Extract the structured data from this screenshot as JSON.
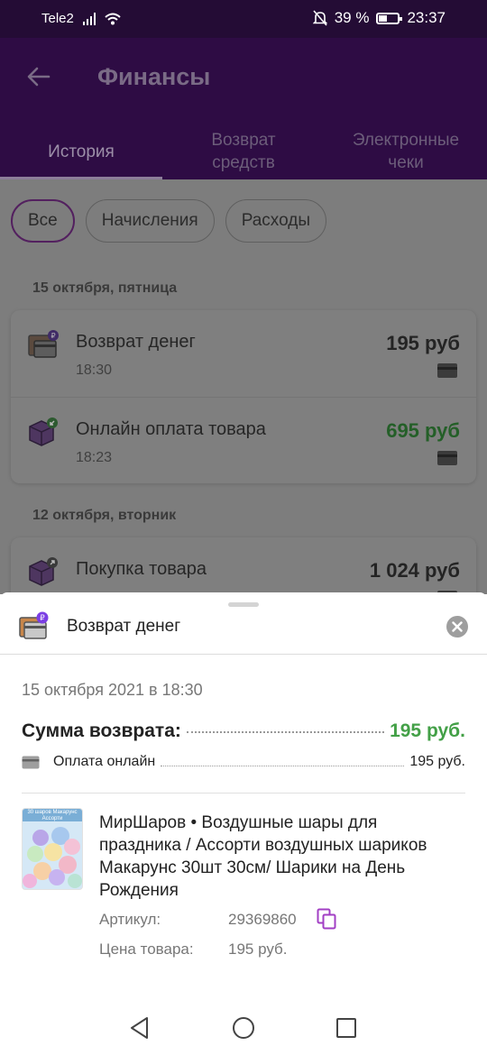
{
  "status_bar": {
    "carrier": "Tele2",
    "battery": "39 %",
    "time": "23:37",
    "battery_level": 0.39
  },
  "header": {
    "title": "Финансы"
  },
  "tabs": [
    {
      "label": "История",
      "active": true
    },
    {
      "label": "Возврат средств",
      "active": false
    },
    {
      "label": "Электронные чеки",
      "active": false
    }
  ],
  "filters": [
    {
      "label": "Все",
      "active": true
    },
    {
      "label": "Начисления",
      "active": false
    },
    {
      "label": "Расходы",
      "active": false
    }
  ],
  "groups": [
    {
      "date": "15 октября, пятница",
      "items": [
        {
          "name": "Возврат денег",
          "time": "18:30",
          "amount": "195 руб",
          "amount_color": "#242424",
          "icon": "wallet-refund-icon"
        },
        {
          "name": "Онлайн оплата товара",
          "time": "18:23",
          "amount": "695 руб",
          "amount_color": "#245f28",
          "icon": "box-payment-icon"
        }
      ]
    },
    {
      "date": "12 октября, вторник",
      "items": [
        {
          "name": "Покупка товара",
          "time": "",
          "amount": "1 024 руб",
          "amount_color": "#242424",
          "icon": "box-purchase-icon"
        }
      ]
    }
  ],
  "sheet": {
    "title": "Возврат денег",
    "date": "15 октября 2021 в 18:30",
    "sum_label": "Сумма возврата:",
    "sum_value": "195 руб.",
    "payment_label": "Оплата онлайн",
    "payment_value": "195 руб.",
    "product": {
      "title": "МирШаров • Воздушные шары для праздника / Ассорти воздушных шариков Макарунс 30шт 30см/ Шарики на День Рождения",
      "image_caption": "30 шаров Макарунс Ассорти",
      "article_label": "Артикул:",
      "article_value": "29369860",
      "price_label": "Цена товара:",
      "price_value": "195 руб."
    }
  },
  "colors": {
    "brand": "#481e75",
    "accent_green": "#43a047",
    "refund_badge": "#7b3fe4"
  }
}
